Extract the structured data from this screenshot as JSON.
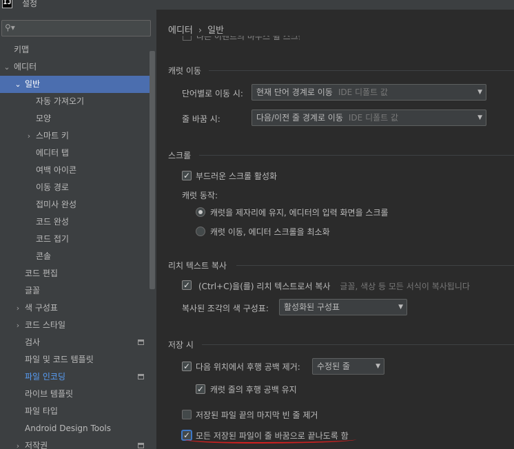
{
  "window": {
    "title": "설정",
    "app_icon": "IJ"
  },
  "search": {
    "placeholder": "",
    "icon": "search-icon"
  },
  "tree": [
    {
      "label": "키맵",
      "level": 0,
      "chevron": ""
    },
    {
      "label": "에디터",
      "level": 0,
      "chevron": "down"
    },
    {
      "label": "일반",
      "level": 1,
      "chevron": "down",
      "selected": true
    },
    {
      "label": "자동 가져오기",
      "level": 2,
      "chevron": ""
    },
    {
      "label": "모양",
      "level": 2,
      "chevron": ""
    },
    {
      "label": "스마트 키",
      "level": 2,
      "chevron": "right"
    },
    {
      "label": "에디터 탭",
      "level": 2,
      "chevron": ""
    },
    {
      "label": "여백 아이콘",
      "level": 2,
      "chevron": ""
    },
    {
      "label": "이동 경로",
      "level": 2,
      "chevron": ""
    },
    {
      "label": "접미사 완성",
      "level": 2,
      "chevron": ""
    },
    {
      "label": "코드 완성",
      "level": 2,
      "chevron": ""
    },
    {
      "label": "코드 접기",
      "level": 2,
      "chevron": ""
    },
    {
      "label": "콘솔",
      "level": 2,
      "chevron": ""
    },
    {
      "label": "코드 편집",
      "level": 1,
      "chevron": ""
    },
    {
      "label": "글꼴",
      "level": 1,
      "chevron": ""
    },
    {
      "label": "색 구성표",
      "level": 1,
      "chevron": "right"
    },
    {
      "label": "코드 스타일",
      "level": 1,
      "chevron": "right"
    },
    {
      "label": "검사",
      "level": 1,
      "chevron": "",
      "project_icon": true
    },
    {
      "label": "파일 및 코드 템플릿",
      "level": 1,
      "chevron": ""
    },
    {
      "label": "파일 인코딩",
      "level": 1,
      "chevron": "",
      "project_icon": true,
      "link": true
    },
    {
      "label": "라이브 템플릿",
      "level": 1,
      "chevron": ""
    },
    {
      "label": "파일 타입",
      "level": 1,
      "chevron": ""
    },
    {
      "label": "Android Design Tools",
      "level": 1,
      "chevron": ""
    },
    {
      "label": "저작권",
      "level": 1,
      "chevron": "right",
      "project_icon": true
    }
  ],
  "breadcrumb": {
    "parent": "에디터",
    "separator": "›",
    "current": "일반"
  },
  "cut_row": "다른 이벤트의 마우스 휠 스크롤",
  "caret_move": {
    "title": "캐럿 이동",
    "word_label": "단어별로 이동 시:",
    "word_value": "현재 단어 경계로 이동",
    "word_hint": "IDE 디폴트 값",
    "line_label": "줄 바꿈 시:",
    "line_value": "다음/이전 줄 경계로 이동",
    "line_hint": "IDE 디폴트 값"
  },
  "scroll": {
    "title": "스크롤",
    "smooth_label": "부드러운 스크롤 활성화",
    "smooth_checked": true,
    "caret_behavior_label": "캐럿 동작:",
    "radio1_label": "캐럿을 제자리에 유지, 에디터의 입력 화면을 스크롤",
    "radio1_checked": true,
    "radio2_label": "캐럿 이동, 에디터 스크롤을 최소화",
    "radio2_checked": false
  },
  "rich_copy": {
    "title": "리치 텍스트 복사",
    "copy_label": "(Ctrl+C)을(를) 리치 텍스트로서 복사",
    "copy_hint": "글꼴, 색상 등 모든 서식이 복사됩니다",
    "copy_checked": true,
    "scheme_label": "복사된 조각의 색 구성표:",
    "scheme_value": "활성화된 구성표"
  },
  "on_save": {
    "title": "저장 시",
    "strip_label": "다음 위치에서 후행 공백 제거:",
    "strip_checked": true,
    "strip_value": "수정된 줄",
    "keep_caret_label": "캐럿 줄의 후행 공백 유지",
    "keep_caret_checked": true,
    "remove_blank_label": "저장된 파일 끝의 마지막 빈 줄 제거",
    "remove_blank_checked": false,
    "ensure_newline_label": "모든 저장된 파일이 줄 바꿈으로 끝나도록 함",
    "ensure_newline_checked": true
  },
  "colors": {
    "selection": "#4b6eaf",
    "link": "#589df6",
    "annotation": "#d02020"
  }
}
